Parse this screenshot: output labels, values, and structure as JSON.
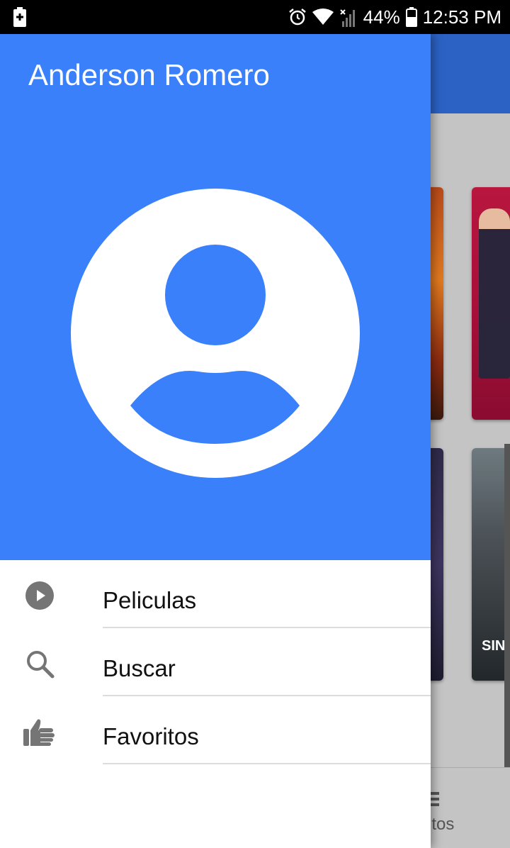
{
  "status_bar": {
    "battery_percent": "44%",
    "time": "12:53 PM"
  },
  "drawer": {
    "account_name": "Anderson Romero",
    "menu": [
      {
        "label": "Peliculas",
        "icon": "play-circle-icon"
      },
      {
        "label": "Buscar",
        "icon": "search-icon"
      },
      {
        "label": "Favoritos",
        "icon": "thumb-up-icon"
      }
    ]
  },
  "background": {
    "bottom_nav_partial_label": "ritos",
    "poster_partial_text": "SIN R"
  },
  "colors": {
    "drawer_header": "#3a80fb",
    "app_bar": "#2b62c4",
    "icon_gray": "#757575"
  }
}
